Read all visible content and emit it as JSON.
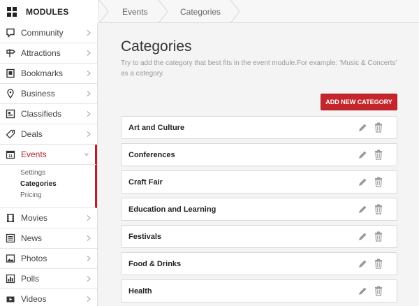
{
  "header": {
    "title": "MODULES",
    "breadcrumbs": [
      "Events",
      "Categories"
    ]
  },
  "sidebar": {
    "items": [
      {
        "label": "Community",
        "icon": "community-icon"
      },
      {
        "label": "Attractions",
        "icon": "attractions-icon"
      },
      {
        "label": "Bookmarks",
        "icon": "bookmarks-icon"
      },
      {
        "label": "Business",
        "icon": "business-icon"
      },
      {
        "label": "Classifieds",
        "icon": "classifieds-icon"
      },
      {
        "label": "Deals",
        "icon": "deals-icon"
      },
      {
        "label": "Events",
        "icon": "events-icon",
        "active": true
      },
      {
        "label": "Movies",
        "icon": "movies-icon"
      },
      {
        "label": "News",
        "icon": "news-icon"
      },
      {
        "label": "Photos",
        "icon": "photos-icon"
      },
      {
        "label": "Polls",
        "icon": "polls-icon"
      },
      {
        "label": "Videos",
        "icon": "videos-icon"
      }
    ],
    "submenu": [
      "Settings",
      "Categories",
      "Pricing"
    ]
  },
  "main": {
    "title": "Categories",
    "description": "Try to add the category that best fits in the event module.For example: 'Music & Concerts' as a category.",
    "add_button": "ADD NEW CATEGORY",
    "categories": [
      "Art and Culture",
      "Conferences",
      "Craft Fair",
      "Education and Learning",
      "Festivals",
      "Food & Drinks",
      "Health"
    ]
  },
  "colors": {
    "accent": "#b81f2d",
    "button": "#c5262c"
  }
}
